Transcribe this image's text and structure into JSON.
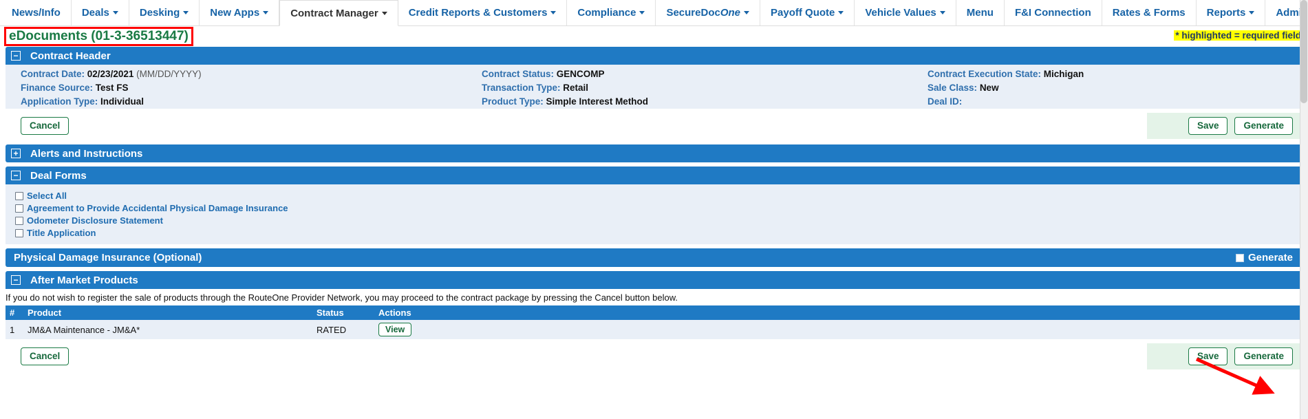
{
  "nav": {
    "items": [
      {
        "label": "News/Info",
        "caret": false,
        "active": false
      },
      {
        "label": "Deals",
        "caret": true,
        "active": false
      },
      {
        "label": "Desking",
        "caret": true,
        "active": false
      },
      {
        "label": "New Apps",
        "caret": true,
        "active": false
      },
      {
        "label": "Contract Manager",
        "caret": true,
        "active": true
      },
      {
        "label": "Credit Reports & Customers",
        "caret": true,
        "active": false
      },
      {
        "label": "Compliance",
        "caret": true,
        "active": false
      },
      {
        "label": "SecureDocOne",
        "caret": true,
        "active": false
      },
      {
        "label": "Payoff Quote",
        "caret": true,
        "active": false
      },
      {
        "label": "Vehicle Values",
        "caret": true,
        "active": false
      },
      {
        "label": "Menu",
        "caret": false,
        "active": false
      },
      {
        "label": "F&I Connection",
        "caret": false,
        "active": false
      },
      {
        "label": "Rates & Forms",
        "caret": false,
        "active": false
      },
      {
        "label": "Reports",
        "caret": true,
        "active": false
      },
      {
        "label": "Admin",
        "caret": true,
        "active": false
      }
    ]
  },
  "header": {
    "page_title": "eDocuments (01-3-36513447)",
    "required_note": "* highlighted = required field"
  },
  "contract_header": {
    "section_title": "Contract Header",
    "toggle_glyph": "−",
    "fields": [
      {
        "label": "Contract Date:",
        "value": "02/23/2021",
        "hint": "(MM/DD/YYYY)"
      },
      {
        "label": "Contract Status:",
        "value": "GENCOMP",
        "hint": ""
      },
      {
        "label": "Contract Execution State:",
        "value": "Michigan",
        "hint": ""
      },
      {
        "label": "Finance Source:",
        "value": "Test FS",
        "hint": ""
      },
      {
        "label": "Transaction Type:",
        "value": "Retail",
        "hint": ""
      },
      {
        "label": "Sale Class:",
        "value": "New",
        "hint": ""
      },
      {
        "label": "Application Type:",
        "value": "Individual",
        "hint": ""
      },
      {
        "label": "Product Type:",
        "value": "Simple Interest Method",
        "hint": ""
      },
      {
        "label": "Deal ID:",
        "value": "",
        "hint": ""
      }
    ],
    "cancel_label": "Cancel",
    "save_label": "Save",
    "generate_label": "Generate"
  },
  "alerts": {
    "section_title": "Alerts and Instructions",
    "toggle_glyph": "+"
  },
  "deal_forms": {
    "section_title": "Deal Forms",
    "toggle_glyph": "−",
    "checkboxes": [
      {
        "label": "Select All",
        "checked": false
      },
      {
        "label": "Agreement to Provide Accidental Physical Damage Insurance",
        "checked": false
      },
      {
        "label": "Odometer Disclosure Statement",
        "checked": false
      },
      {
        "label": "Title Application",
        "checked": false
      }
    ]
  },
  "physical_damage": {
    "section_title": "Physical Damage Insurance (Optional)",
    "generate_label": "Generate",
    "generate_checked": false
  },
  "after_market": {
    "section_title": "After Market Products",
    "toggle_glyph": "−",
    "note": "If you do not wish to register the sale of products through the RouteOne Provider Network, you may proceed to the contract package by pressing the Cancel button below.",
    "columns": [
      "#",
      "Product",
      "Status",
      "Actions"
    ],
    "rows": [
      {
        "num": "1",
        "product": "JM&A Maintenance - JM&A*",
        "status": "RATED",
        "action": "View"
      }
    ],
    "cancel_label": "Cancel",
    "save_label": "Save",
    "generate_label": "Generate"
  },
  "colors": {
    "nav_link": "#1763a6",
    "panel_header": "#1f7ac4",
    "panel_body": "#e9eff7",
    "title_green": "#1a7a44",
    "annotation_red": "#ff0000",
    "highlight_yellow": "#ffff00",
    "button_green_border": "#1a7a44"
  }
}
